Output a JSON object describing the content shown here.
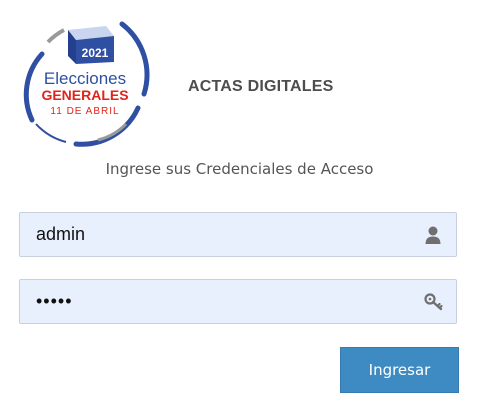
{
  "logo": {
    "year": "2021",
    "line1": "Elecciones",
    "line2": "GENERALES",
    "line3": "11 DE ABRIL",
    "colors": {
      "blue": "#2f4fa3",
      "red": "#e2231a",
      "gray": "#9a9a9a"
    }
  },
  "app": {
    "title": "ACTAS DIGITALES"
  },
  "login": {
    "subtitle": "Ingrese sus Credenciales de Acceso",
    "username_value": "admin",
    "password_value": "•••••",
    "submit_label": "Ingresar",
    "username_icon": "user-icon",
    "password_icon": "key-icon"
  },
  "colors": {
    "accent": "#3d8bc2",
    "field_bg": "#e8f0fe"
  }
}
